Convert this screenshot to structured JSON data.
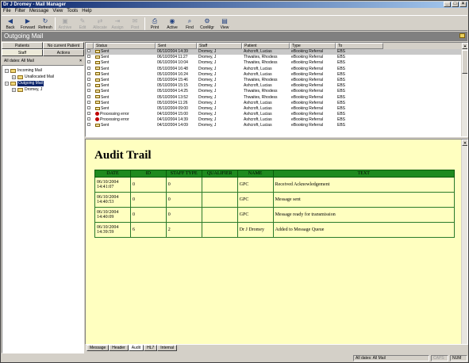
{
  "window": {
    "title": "Dr J Dromey - Mail Manager"
  },
  "menu": [
    "File",
    "Filter",
    "Message",
    "View",
    "Tools",
    "Help"
  ],
  "toolbar": [
    {
      "label": "Back",
      "icon": "back-arrow-icon",
      "enabled": true
    },
    {
      "label": "Forward",
      "icon": "forward-arrow-icon",
      "enabled": true
    },
    {
      "label": "Refresh",
      "icon": "refresh-icon",
      "enabled": true
    },
    {
      "label": "Archive",
      "icon": "archive-icon",
      "enabled": false
    },
    {
      "label": "Edit",
      "icon": "edit-icon",
      "enabled": false
    },
    {
      "label": "Allocate",
      "icon": "allocate-icon",
      "enabled": false
    },
    {
      "label": "Assign",
      "icon": "assign-icon",
      "enabled": false
    },
    {
      "label": "Post",
      "icon": "post-icon",
      "enabled": false
    },
    {
      "label": "Print",
      "icon": "print-icon",
      "enabled": true
    },
    {
      "label": "Active",
      "icon": "active-icon",
      "enabled": true
    },
    {
      "label": "Find",
      "icon": "find-icon",
      "enabled": true
    },
    {
      "label": "ConMgr",
      "icon": "conmgr-icon",
      "enabled": true
    },
    {
      "label": "View",
      "icon": "view-icon",
      "enabled": true
    }
  ],
  "header": {
    "title": "Outgoing Mail"
  },
  "left": {
    "tabs_top": [
      "Patients",
      "No current Patient"
    ],
    "tabs_bottom": [
      "Staff",
      "Actions"
    ],
    "filter": "All dates: All Mail",
    "tree": [
      {
        "label": "Incoming Mail",
        "level": 0
      },
      {
        "label": "Unallocated Mail",
        "level": 1
      },
      {
        "label": "Outgoing Mail",
        "level": 0,
        "selected": true
      },
      {
        "label": "Dromey, J",
        "level": 1
      }
    ]
  },
  "grid": {
    "columns": [
      "",
      "Status",
      "Sent",
      "Staff",
      "Patient",
      "Type",
      "To"
    ],
    "rows": [
      {
        "status": "Sent",
        "sent": "06/10/2004 14:39",
        "staff": "Dromey, J",
        "patient": "Ashcroft, Lucias",
        "type": "eBooking Referral",
        "to": "EBS",
        "selected": true
      },
      {
        "status": "Sent",
        "sent": "06/10/2004 11:27",
        "staff": "Dromey, J",
        "patient": "Thwaites, Rhodess",
        "type": "eBooking Referral",
        "to": "EBS"
      },
      {
        "status": "Sent",
        "sent": "06/10/2004 10:04",
        "staff": "Dromey, J",
        "patient": "Thwaites, Rhodess",
        "type": "eBooking Referral",
        "to": "EBS"
      },
      {
        "status": "Sent",
        "sent": "05/10/2004 16:48",
        "staff": "Dromey, J",
        "patient": "Ashcroft, Lucias",
        "type": "eBooking Referral",
        "to": "EBS"
      },
      {
        "status": "Sent",
        "sent": "05/10/2004 16:24",
        "staff": "Dromey, J",
        "patient": "Ashcroft, Lucias",
        "type": "eBooking Referral",
        "to": "EBS"
      },
      {
        "status": "Sent",
        "sent": "05/10/2004 15:46",
        "staff": "Dromey, J",
        "patient": "Thwaites, Rhodess",
        "type": "eBooking Referral",
        "to": "EBS"
      },
      {
        "status": "Sent",
        "sent": "05/10/2004 15:15",
        "staff": "Dromey, J",
        "patient": "Ashcroft, Lucias",
        "type": "eBooking Referral",
        "to": "EBS"
      },
      {
        "status": "Sent",
        "sent": "05/10/2004 14:25",
        "staff": "Dromey, J",
        "patient": "Thwaites, Rhodess",
        "type": "eBooking Referral",
        "to": "EBS"
      },
      {
        "status": "Sent",
        "sent": "05/10/2004 13:52",
        "staff": "Dromey, J",
        "patient": "Thwaites, Rhodess",
        "type": "eBooking Referral",
        "to": "EBS"
      },
      {
        "status": "Sent",
        "sent": "05/10/2004 11:26",
        "staff": "Dromey, J",
        "patient": "Ashcroft, Lucias",
        "type": "eBooking Referral",
        "to": "EBS"
      },
      {
        "status": "Sent",
        "sent": "05/10/2004 09:00",
        "staff": "Dromey, J",
        "patient": "Ashcroft, Lucias",
        "type": "eBooking Referral",
        "to": "EBS"
      },
      {
        "status": "Processing error",
        "sent": "04/10/2004 15:00",
        "staff": "Dromey, J",
        "patient": "Ashcroft, Lucias",
        "type": "eBooking Referral",
        "to": "EBS",
        "error": true
      },
      {
        "status": "Processing error",
        "sent": "04/10/2004 14:39",
        "staff": "Dromey, J",
        "patient": "Ashcroft, Lucias",
        "type": "eBooking Referral",
        "to": "EBS",
        "error": true
      },
      {
        "status": "Sent",
        "sent": "04/10/2004 14:09",
        "staff": "Dromey, J",
        "patient": "Ashcroft, Lucias",
        "type": "eBooking Referral",
        "to": "EBS"
      }
    ]
  },
  "preview": {
    "title": "Audit Trail",
    "columns": [
      "DATE",
      "ID",
      "STAFF TYPE",
      "QUALIFIER",
      "NAME",
      "TEXT"
    ],
    "rows": [
      [
        "06/10/2004 14:41:07",
        "0",
        "0",
        "",
        "GPC",
        "Received Acknowledgement"
      ],
      [
        "06/10/2004 14:40:53",
        "0",
        "0",
        "",
        "GPC",
        "Message sent"
      ],
      [
        "06/10/2004 14:40:09",
        "0",
        "0",
        "",
        "GPC",
        "Message ready for transmission"
      ],
      [
        "06/10/2004 14:39:59",
        "6",
        "2",
        "",
        "Dr J Dromey",
        "Added to Message Queue"
      ]
    ]
  },
  "bottom_tabs": [
    "Message",
    "Header",
    "Audit",
    "HL7",
    "Internal"
  ],
  "active_bottom_tab": "Audit",
  "status": {
    "filter": "All dates: All Mail",
    "caps": "CAPS",
    "num": "NUM"
  }
}
